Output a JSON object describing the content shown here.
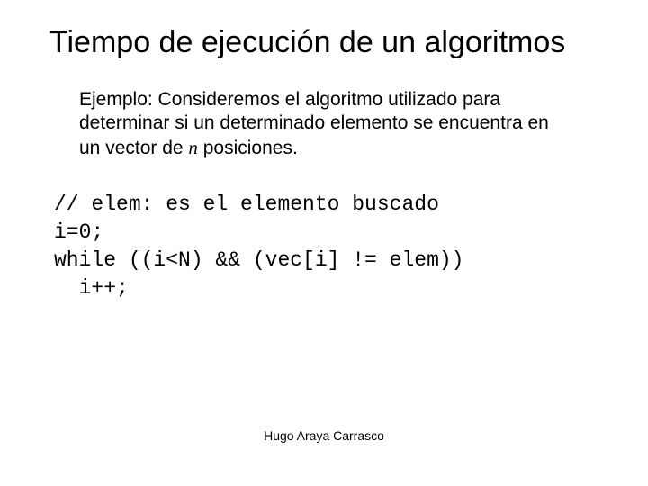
{
  "title": "Tiempo de ejecución de un algoritmos",
  "intro": {
    "part1": "Ejemplo: Consideremos el algoritmo utilizado para determinar si un determinado elemento se encuentra en un vector de ",
    "n": "n",
    "part2": " posiciones."
  },
  "code": {
    "line1": "// elem: es el elemento buscado",
    "line2": "i=0;",
    "line3": "while ((i<N) && (vec[i] != elem))",
    "line4": "  i++;"
  },
  "footer": "Hugo Araya Carrasco"
}
